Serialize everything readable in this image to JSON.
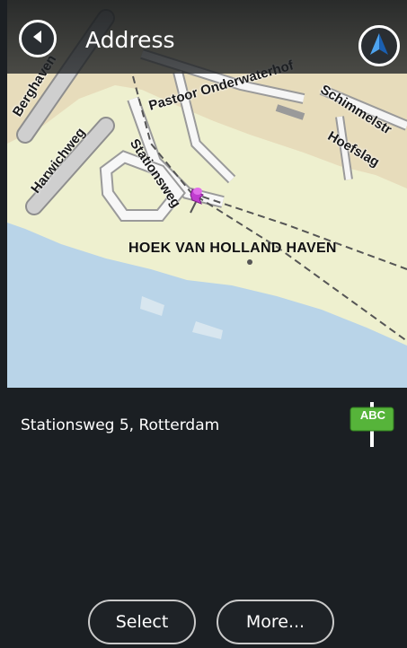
{
  "header": {
    "title": "Address",
    "back_icon": "back-arrow-icon",
    "nav_icon": "navigation-arrow-icon"
  },
  "map": {
    "streets": [
      "Berghaven",
      "Harwichweg",
      "Pastoor Onderwaterhof",
      "Stationsweg",
      "Schimmelstr",
      "Hoefslag"
    ],
    "place_label": "HOEK VAN HOLLAND HAVEN",
    "pin_icon": "location-pin-icon"
  },
  "location": {
    "address": "Stationsweg 5, Rotterdam",
    "sign_text": "ABC"
  },
  "buttons": {
    "select_label": "Select",
    "more_label": "More..."
  },
  "colors": {
    "background": "#1b1f23",
    "water": "#b9d4e8",
    "land": "#eef0cf",
    "urban": "#e7dcbb",
    "road": "#a9a9a9",
    "pin": "#c03ccf",
    "sign": "#56b43a"
  }
}
